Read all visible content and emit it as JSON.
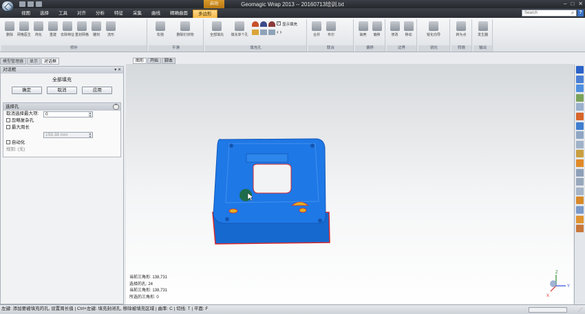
{
  "titlebar": {
    "title": "Geomagic Wrap 2013 -- 20160713培训.txt",
    "context_tab": "启动",
    "minimize": "–",
    "maximize": "□",
    "close": "✕"
  },
  "menu": {
    "tabs": [
      "视图",
      "选择",
      "工具",
      "对齐",
      "分析",
      "特征",
      "采集",
      "曲线",
      "精确曲面",
      "多边形"
    ],
    "active_tab": "多边形",
    "search_placeholder": "Search",
    "help": "?"
  },
  "ribbon": {
    "groups": [
      {
        "label": "修补",
        "buttons": [
          "删除",
          "网格医生",
          "简化",
          "重建",
          "去除特征",
          "重划网格",
          "雕刻",
          "流形"
        ]
      },
      {
        "label": "平滑",
        "buttons": [
          "松弛",
          "删除钉状物"
        ]
      },
      {
        "label": "填充孔",
        "buttons": [
          "全部填充",
          "填充单个孔"
        ],
        "checkbox_label": "显示填充"
      },
      {
        "label": "联合",
        "buttons": [
          "合并",
          "布尔"
        ]
      },
      {
        "label": "偏移",
        "buttons": [
          "抽壳",
          "偏移"
        ]
      },
      {
        "label": "边界",
        "buttons": [
          "修改",
          "移动"
        ]
      },
      {
        "label": "锐化",
        "buttons": [
          "锐化向导"
        ]
      },
      {
        "label": "转换",
        "buttons": [
          "转为点"
        ]
      },
      {
        "label": "输出",
        "buttons": [
          "发生器"
        ]
      }
    ]
  },
  "left_panel": {
    "tabs": [
      "模型管理器",
      "显示",
      "对话框"
    ],
    "active_tab": "对话框",
    "header": "对话框",
    "pin": "▾ ✕",
    "title": "全部填充",
    "buttons": {
      "ok": "确定",
      "cancel": "取消",
      "apply": "应用"
    },
    "section": {
      "title": "选择孔",
      "collapse": "⌃",
      "max_deselect_label": "取消选择最大项:",
      "max_deselect_value": "0",
      "ignore_complex": "忽略复杂孔",
      "max_perimeter": "最大周长",
      "perimeter_value": "159.38 mm",
      "automate": "自动化",
      "rule": "规则: (无)"
    }
  },
  "viewport": {
    "tabs": [
      "图形",
      "开始",
      "脚本"
    ],
    "active_tab": "图形",
    "readout": [
      "当前三角形: 138,731",
      "选择的孔: 24",
      "当前三角形: 138,731",
      "所选的三角形: 0"
    ],
    "triad": {
      "x": "X",
      "y": "Y",
      "z": "Z"
    }
  },
  "status": {
    "text": "左键: 添加要被填充的孔, 设置周长值 | Ctrl+左键: 填充封闭孔, 移除被填充区域 | 曲率: C | 切线: T | 平面: F"
  },
  "colors": {
    "mesh_blue": "#1e78e6",
    "hole_red": "#d8282c",
    "active_tab": "#f5b94a",
    "cursor_marker": "#1e6a3a"
  }
}
